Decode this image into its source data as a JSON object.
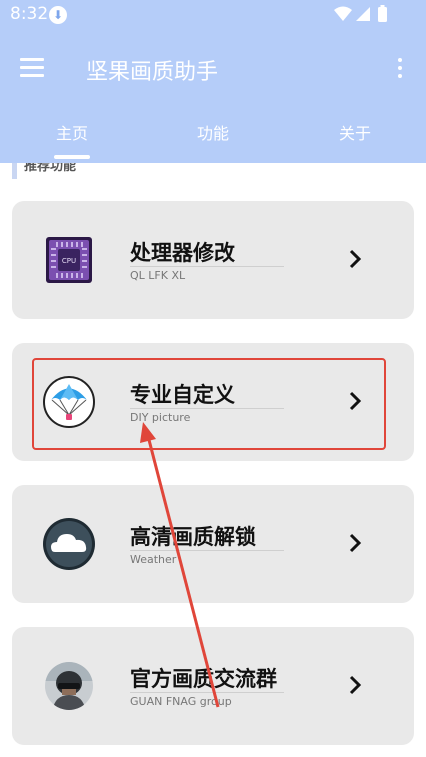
{
  "status_bar": {
    "time": "8:32"
  },
  "app_bar": {
    "title": "坚果画质助手",
    "tabs": [
      {
        "label": "主页",
        "active": true
      },
      {
        "label": "功能",
        "active": false
      },
      {
        "label": "关于",
        "active": false
      }
    ]
  },
  "section": {
    "title": "推荐功能"
  },
  "cards": [
    {
      "title": "处理器修改",
      "subtitle": "QL LFK XL",
      "icon": "cpu-icon"
    },
    {
      "title": "专业自定义",
      "subtitle": "DIY picture",
      "icon": "parachute-icon"
    },
    {
      "title": "高清画质解锁",
      "subtitle": "Weather",
      "icon": "cloud-icon"
    },
    {
      "title": "官方画质交流群",
      "subtitle": "GUAN FNAG group",
      "icon": "avatar-icon"
    }
  ],
  "colors": {
    "app_bar": "#b5cdf9",
    "card_bg": "#e9e9e9",
    "annotation": "#e0463a"
  }
}
